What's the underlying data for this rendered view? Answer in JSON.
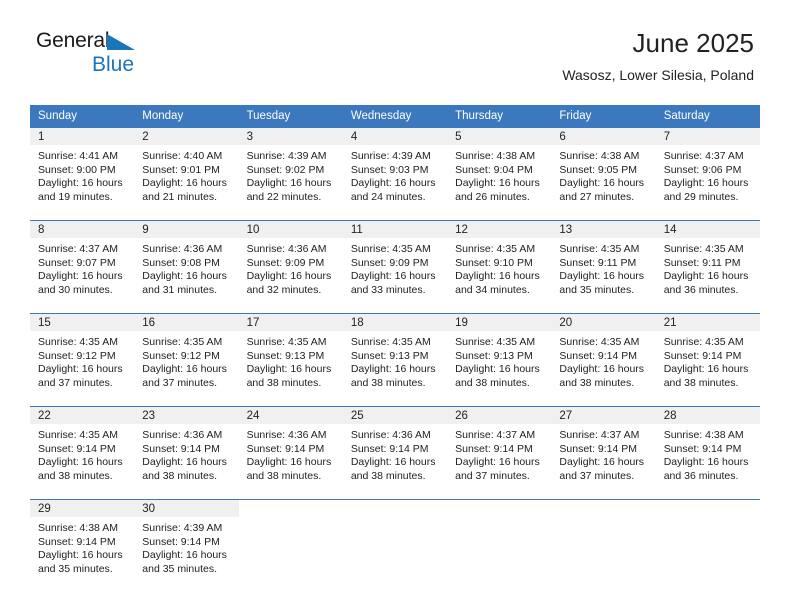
{
  "brand": {
    "name_top": "General",
    "name_bottom": "Blue",
    "accent_color": "#1b75bb",
    "logo_icon": "triangle-logo-icon"
  },
  "header": {
    "title": "June 2025",
    "subtitle": "Wasosz, Lower Silesia, Poland"
  },
  "theme": {
    "header_bg": "#3b78bd",
    "header_text": "#ffffff",
    "daynum_bg": "#f0f0f0",
    "body_text": "#222222"
  },
  "weekdays": [
    "Sunday",
    "Monday",
    "Tuesday",
    "Wednesday",
    "Thursday",
    "Friday",
    "Saturday"
  ],
  "weeks": [
    [
      {
        "day": "1",
        "lines": [
          "Sunrise: 4:41 AM",
          "Sunset: 9:00 PM",
          "Daylight: 16 hours",
          "and 19 minutes."
        ]
      },
      {
        "day": "2",
        "lines": [
          "Sunrise: 4:40 AM",
          "Sunset: 9:01 PM",
          "Daylight: 16 hours",
          "and 21 minutes."
        ]
      },
      {
        "day": "3",
        "lines": [
          "Sunrise: 4:39 AM",
          "Sunset: 9:02 PM",
          "Daylight: 16 hours",
          "and 22 minutes."
        ]
      },
      {
        "day": "4",
        "lines": [
          "Sunrise: 4:39 AM",
          "Sunset: 9:03 PM",
          "Daylight: 16 hours",
          "and 24 minutes."
        ]
      },
      {
        "day": "5",
        "lines": [
          "Sunrise: 4:38 AM",
          "Sunset: 9:04 PM",
          "Daylight: 16 hours",
          "and 26 minutes."
        ]
      },
      {
        "day": "6",
        "lines": [
          "Sunrise: 4:38 AM",
          "Sunset: 9:05 PM",
          "Daylight: 16 hours",
          "and 27 minutes."
        ]
      },
      {
        "day": "7",
        "lines": [
          "Sunrise: 4:37 AM",
          "Sunset: 9:06 PM",
          "Daylight: 16 hours",
          "and 29 minutes."
        ]
      }
    ],
    [
      {
        "day": "8",
        "lines": [
          "Sunrise: 4:37 AM",
          "Sunset: 9:07 PM",
          "Daylight: 16 hours",
          "and 30 minutes."
        ]
      },
      {
        "day": "9",
        "lines": [
          "Sunrise: 4:36 AM",
          "Sunset: 9:08 PM",
          "Daylight: 16 hours",
          "and 31 minutes."
        ]
      },
      {
        "day": "10",
        "lines": [
          "Sunrise: 4:36 AM",
          "Sunset: 9:09 PM",
          "Daylight: 16 hours",
          "and 32 minutes."
        ]
      },
      {
        "day": "11",
        "lines": [
          "Sunrise: 4:35 AM",
          "Sunset: 9:09 PM",
          "Daylight: 16 hours",
          "and 33 minutes."
        ]
      },
      {
        "day": "12",
        "lines": [
          "Sunrise: 4:35 AM",
          "Sunset: 9:10 PM",
          "Daylight: 16 hours",
          "and 34 minutes."
        ]
      },
      {
        "day": "13",
        "lines": [
          "Sunrise: 4:35 AM",
          "Sunset: 9:11 PM",
          "Daylight: 16 hours",
          "and 35 minutes."
        ]
      },
      {
        "day": "14",
        "lines": [
          "Sunrise: 4:35 AM",
          "Sunset: 9:11 PM",
          "Daylight: 16 hours",
          "and 36 minutes."
        ]
      }
    ],
    [
      {
        "day": "15",
        "lines": [
          "Sunrise: 4:35 AM",
          "Sunset: 9:12 PM",
          "Daylight: 16 hours",
          "and 37 minutes."
        ]
      },
      {
        "day": "16",
        "lines": [
          "Sunrise: 4:35 AM",
          "Sunset: 9:12 PM",
          "Daylight: 16 hours",
          "and 37 minutes."
        ]
      },
      {
        "day": "17",
        "lines": [
          "Sunrise: 4:35 AM",
          "Sunset: 9:13 PM",
          "Daylight: 16 hours",
          "and 38 minutes."
        ]
      },
      {
        "day": "18",
        "lines": [
          "Sunrise: 4:35 AM",
          "Sunset: 9:13 PM",
          "Daylight: 16 hours",
          "and 38 minutes."
        ]
      },
      {
        "day": "19",
        "lines": [
          "Sunrise: 4:35 AM",
          "Sunset: 9:13 PM",
          "Daylight: 16 hours",
          "and 38 minutes."
        ]
      },
      {
        "day": "20",
        "lines": [
          "Sunrise: 4:35 AM",
          "Sunset: 9:14 PM",
          "Daylight: 16 hours",
          "and 38 minutes."
        ]
      },
      {
        "day": "21",
        "lines": [
          "Sunrise: 4:35 AM",
          "Sunset: 9:14 PM",
          "Daylight: 16 hours",
          "and 38 minutes."
        ]
      }
    ],
    [
      {
        "day": "22",
        "lines": [
          "Sunrise: 4:35 AM",
          "Sunset: 9:14 PM",
          "Daylight: 16 hours",
          "and 38 minutes."
        ]
      },
      {
        "day": "23",
        "lines": [
          "Sunrise: 4:36 AM",
          "Sunset: 9:14 PM",
          "Daylight: 16 hours",
          "and 38 minutes."
        ]
      },
      {
        "day": "24",
        "lines": [
          "Sunrise: 4:36 AM",
          "Sunset: 9:14 PM",
          "Daylight: 16 hours",
          "and 38 minutes."
        ]
      },
      {
        "day": "25",
        "lines": [
          "Sunrise: 4:36 AM",
          "Sunset: 9:14 PM",
          "Daylight: 16 hours",
          "and 38 minutes."
        ]
      },
      {
        "day": "26",
        "lines": [
          "Sunrise: 4:37 AM",
          "Sunset: 9:14 PM",
          "Daylight: 16 hours",
          "and 37 minutes."
        ]
      },
      {
        "day": "27",
        "lines": [
          "Sunrise: 4:37 AM",
          "Sunset: 9:14 PM",
          "Daylight: 16 hours",
          "and 37 minutes."
        ]
      },
      {
        "day": "28",
        "lines": [
          "Sunrise: 4:38 AM",
          "Sunset: 9:14 PM",
          "Daylight: 16 hours",
          "and 36 minutes."
        ]
      }
    ],
    [
      {
        "day": "29",
        "lines": [
          "Sunrise: 4:38 AM",
          "Sunset: 9:14 PM",
          "Daylight: 16 hours",
          "and 35 minutes."
        ]
      },
      {
        "day": "30",
        "lines": [
          "Sunrise: 4:39 AM",
          "Sunset: 9:14 PM",
          "Daylight: 16 hours",
          "and 35 minutes."
        ]
      },
      {
        "day": "",
        "lines": []
      },
      {
        "day": "",
        "lines": []
      },
      {
        "day": "",
        "lines": []
      },
      {
        "day": "",
        "lines": []
      },
      {
        "day": "",
        "lines": []
      }
    ]
  ]
}
